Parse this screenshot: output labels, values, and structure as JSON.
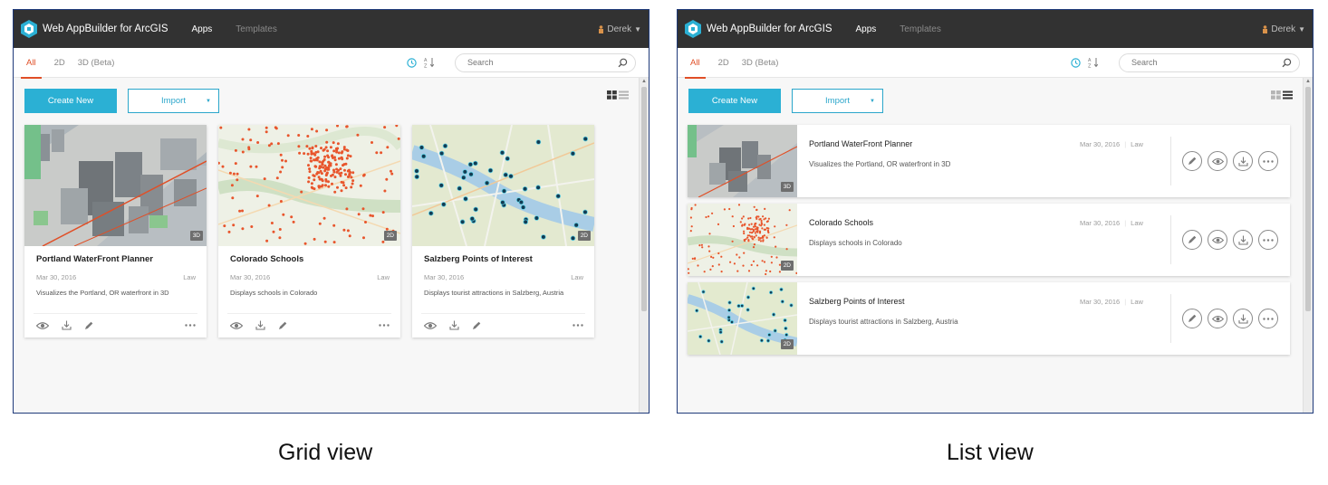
{
  "app": {
    "title": "Web AppBuilder for ArcGIS",
    "accent": "#2bb0d4",
    "active_tab_color": "#e04f27",
    "topbar_color": "#323232"
  },
  "nav": {
    "apps": "Apps",
    "templates": "Templates"
  },
  "user": {
    "name": "Derek"
  },
  "tabs": [
    {
      "label": "All",
      "active": true
    },
    {
      "label": "2D"
    },
    {
      "label": "3D (Beta)"
    }
  ],
  "search": {
    "placeholder": "Search"
  },
  "toolbar": {
    "create_label": "Create New",
    "import_label": "Import"
  },
  "apps": [
    {
      "title": "Portland WaterFront Planner",
      "date": "Mar 30, 2016",
      "owner": "Law",
      "description": "Visualizes the Portland, OR waterfront in 3D",
      "badge": "3D"
    },
    {
      "title": "Colorado Schools",
      "date": "Mar 30, 2016",
      "owner": "Law",
      "description": "Displays schools in Colorado",
      "badge": "2D"
    },
    {
      "title": "Salzberg Points of Interest",
      "date": "Mar 30, 2016",
      "owner": "Law",
      "description": "Displays tourist attractions in Salzberg, Austria",
      "badge": "2D"
    }
  ],
  "captions": {
    "grid": "Grid view",
    "list": "List view"
  },
  "icons": {
    "card_actions": [
      "eye-icon",
      "download-icon",
      "pencil-icon",
      "more-icon"
    ],
    "row_actions": [
      "pencil-icon",
      "eye-icon",
      "download-icon",
      "more-icon"
    ],
    "sort": [
      "clock-icon",
      "sort-az-icon"
    ],
    "view": [
      "grid-view-icon",
      "list-view-icon"
    ]
  }
}
